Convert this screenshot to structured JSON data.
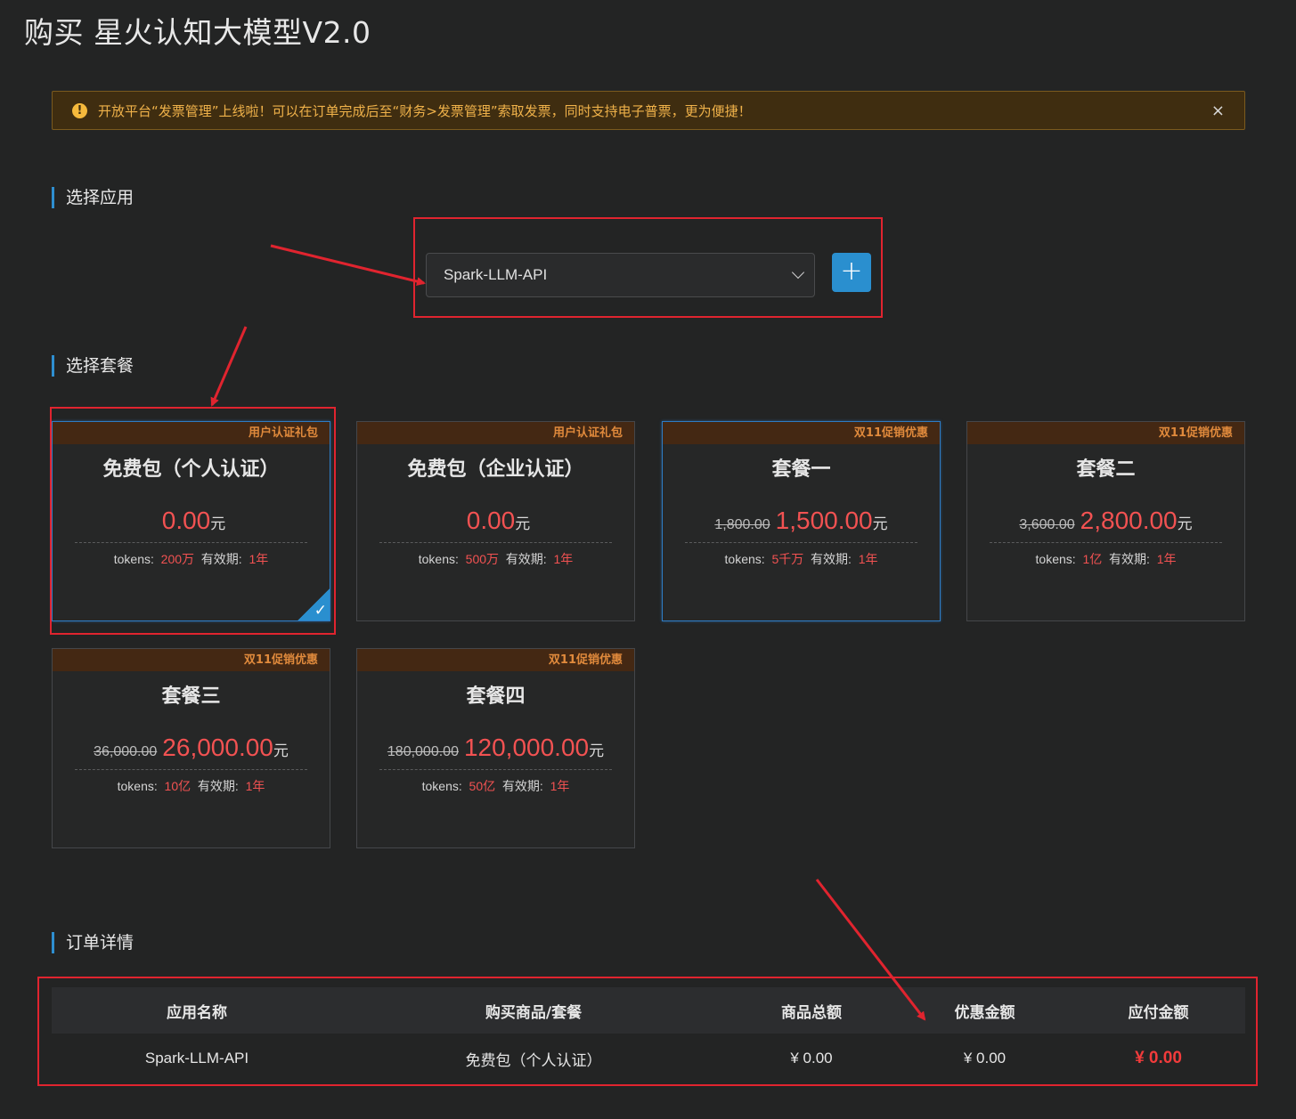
{
  "title": "购买 星火认知大模型V2.0",
  "notice": {
    "icon": "warning-icon",
    "text": "开放平台“发票管理”上线啦！可以在订单完成后至“财务>发票管理”索取发票，同时支持电子普票，更为便捷！",
    "close": "×"
  },
  "sections": {
    "app": "选择应用",
    "package": "选择套餐",
    "order": "订单详情"
  },
  "app_select": {
    "value": "Spark-LLM-API",
    "add_label": "+"
  },
  "packages": [
    {
      "tag": "用户认证礼包",
      "name": "免费包（个人认证）",
      "orig": "",
      "price": "0.00",
      "unit": "元",
      "tokens_label": "tokens:",
      "tokens": "200万",
      "validity_label": "有效期:",
      "validity": "1年",
      "selected": true
    },
    {
      "tag": "用户认证礼包",
      "name": "免费包（企业认证）",
      "orig": "",
      "price": "0.00",
      "unit": "元",
      "tokens_label": "tokens:",
      "tokens": "500万",
      "validity_label": "有效期:",
      "validity": "1年",
      "selected": false
    },
    {
      "tag": "双11促销优惠",
      "name": "套餐一",
      "orig": "1,800.00",
      "price": "1,500.00",
      "unit": "元",
      "tokens_label": "tokens:",
      "tokens": "5千万",
      "validity_label": "有效期:",
      "validity": "1年",
      "selected": false
    },
    {
      "tag": "双11促销优惠",
      "name": "套餐二",
      "orig": "3,600.00",
      "price": "2,800.00",
      "unit": "元",
      "tokens_label": "tokens:",
      "tokens": "1亿",
      "validity_label": "有效期:",
      "validity": "1年",
      "selected": false
    },
    {
      "tag": "双11促销优惠",
      "name": "套餐三",
      "orig": "36,000.00",
      "price": "26,000.00",
      "unit": "元",
      "tokens_label": "tokens:",
      "tokens": "10亿",
      "validity_label": "有效期:",
      "validity": "1年",
      "selected": false
    },
    {
      "tag": "双11促销优惠",
      "name": "套餐四",
      "orig": "180,000.00",
      "price": "120,000.00",
      "unit": "元",
      "tokens_label": "tokens:",
      "tokens": "50亿",
      "validity_label": "有效期:",
      "validity": "1年",
      "selected": false
    }
  ],
  "order": {
    "headers": [
      "应用名称",
      "购买商品/套餐",
      "商品总额",
      "优惠金额",
      "应付金额"
    ],
    "row": [
      "Spark-LLM-API",
      "免费包（个人认证）",
      "¥ 0.00",
      "¥ 0.00",
      "¥ 0.00"
    ]
  },
  "colors": {
    "accent": "#2a8fcf",
    "price_red": "#f25252",
    "annotation_red": "#e0242f"
  }
}
